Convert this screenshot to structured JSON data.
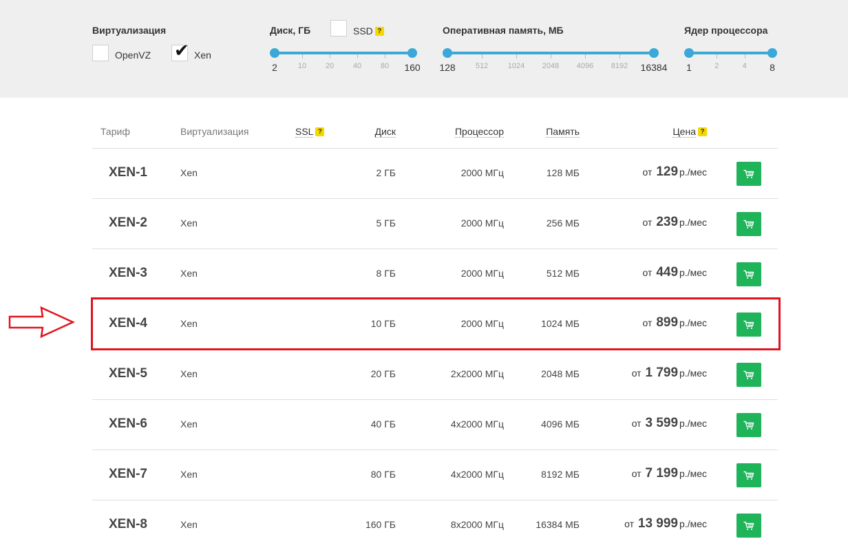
{
  "filters": {
    "virtualization": {
      "title": "Виртуализация",
      "options": [
        {
          "label": "OpenVZ",
          "checked": false
        },
        {
          "label": "Xen",
          "checked": true
        }
      ]
    },
    "disk": {
      "title": "Диск, ГБ",
      "ssd_label": "SSD",
      "ssd_checked": false,
      "help": "?",
      "ticks": [
        "2",
        "10",
        "20",
        "40",
        "80",
        "160"
      ],
      "range": [
        "2",
        "160"
      ]
    },
    "ram": {
      "title": "Оперативная память, МБ",
      "ticks": [
        "128",
        "512",
        "1024",
        "2048",
        "4096",
        "8192",
        "16384"
      ],
      "range": [
        "128",
        "16384"
      ]
    },
    "cpu": {
      "title": "Ядер процессора",
      "ticks": [
        "1",
        "2",
        "4",
        "8"
      ],
      "range": [
        "1",
        "8"
      ]
    }
  },
  "table": {
    "headers": {
      "tariff": "Тариф",
      "virtualization": "Виртуализация",
      "ssl": "SSL",
      "disk": "Диск",
      "cpu": "Процессор",
      "ram": "Память",
      "price": "Цена",
      "help": "?"
    },
    "price_prefix": "от",
    "price_suffix": "р./мес",
    "rows": [
      {
        "name": "XEN-1",
        "virt": "Xen",
        "disk": "2 ГБ",
        "cpu": "2000 МГц",
        "ram": "128 МБ",
        "price": "129"
      },
      {
        "name": "XEN-2",
        "virt": "Xen",
        "disk": "5 ГБ",
        "cpu": "2000 МГц",
        "ram": "256 МБ",
        "price": "239"
      },
      {
        "name": "XEN-3",
        "virt": "Xen",
        "disk": "8 ГБ",
        "cpu": "2000 МГц",
        "ram": "512 МБ",
        "price": "449"
      },
      {
        "name": "XEN-4",
        "virt": "Xen",
        "disk": "10 ГБ",
        "cpu": "2000 МГц",
        "ram": "1024 МБ",
        "price": "899"
      },
      {
        "name": "XEN-5",
        "virt": "Xen",
        "disk": "20 ГБ",
        "cpu": "2x2000 МГц",
        "ram": "2048 МБ",
        "price": "1 799"
      },
      {
        "name": "XEN-6",
        "virt": "Xen",
        "disk": "40 ГБ",
        "cpu": "4x2000 МГц",
        "ram": "4096 МБ",
        "price": "3 599"
      },
      {
        "name": "XEN-7",
        "virt": "Xen",
        "disk": "80 ГБ",
        "cpu": "4x2000 МГц",
        "ram": "8192 МБ",
        "price": "7 199"
      },
      {
        "name": "XEN-8",
        "virt": "Xen",
        "disk": "160 ГБ",
        "cpu": "8x2000 МГц",
        "ram": "16384 МБ",
        "price": "13 999"
      }
    ],
    "highlighted_row": "XEN-4"
  },
  "colors": {
    "accent": "#3aa8d8",
    "cart_button": "#1fb35a",
    "help_badge": "#f5d800",
    "annotation": "#e0131d"
  },
  "icons": {
    "cart": "cart-icon",
    "help": "help-badge-icon",
    "arrow": "arrow-right-outline-icon"
  }
}
